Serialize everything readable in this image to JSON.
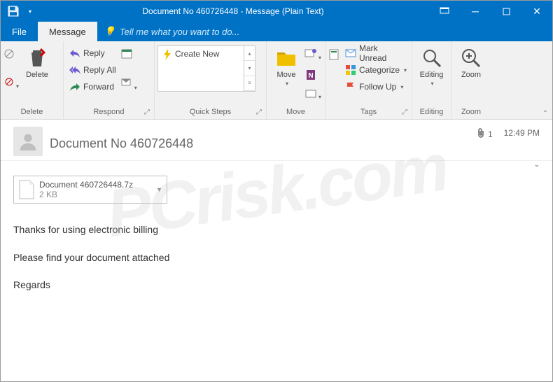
{
  "window": {
    "title": "Document No 460726448 - Message (Plain Text)"
  },
  "tabs": {
    "file": "File",
    "message": "Message",
    "tellme": "Tell me what you want to do..."
  },
  "ribbon": {
    "delete_group": "Delete",
    "delete": "Delete",
    "respond_group": "Respond",
    "reply": "Reply",
    "reply_all": "Reply All",
    "forward": "Forward",
    "quicksteps_group": "Quick Steps",
    "create_new": "Create New",
    "move_group": "Move",
    "move": "Move",
    "tags_group": "Tags",
    "mark_unread": "Mark Unread",
    "categorize": "Categorize",
    "follow_up": "Follow Up",
    "editing_group": "Editing",
    "editing": "Editing",
    "zoom_group": "Zoom",
    "zoom": "Zoom"
  },
  "message": {
    "subject": "Document No 460726448",
    "attach_count": "1",
    "time": "12:49 PM",
    "attachment_name": "Document 460726448.7z",
    "attachment_size": "2 KB",
    "body_line1": "Thanks for using electronic billing",
    "body_line2": "Please find your document attached",
    "body_line3": "Regards"
  },
  "watermark": "PCrisk.com"
}
